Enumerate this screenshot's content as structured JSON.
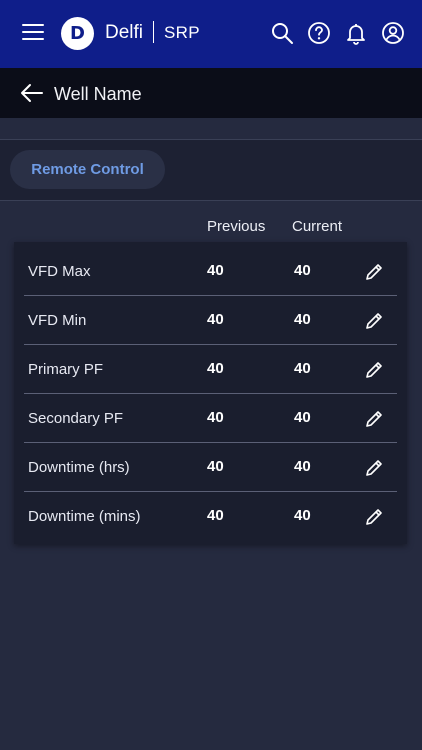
{
  "header": {
    "brand": "Delfi",
    "product": "SRP",
    "icons": [
      "menu-icon",
      "search-icon",
      "help-icon",
      "bell-icon",
      "user-icon"
    ],
    "color": "#0f1e8a"
  },
  "subheader": {
    "title": "Well Name"
  },
  "tabs": [
    {
      "label": "Remote Control",
      "active": true
    }
  ],
  "table": {
    "columns": {
      "previous": "Previous",
      "current": "Current"
    },
    "rows": [
      {
        "label": "VFD Max",
        "previous": "40",
        "current": "40"
      },
      {
        "label": "VFD Min",
        "previous": "40",
        "current": "40"
      },
      {
        "label": "Primary PF",
        "previous": "40",
        "current": "40"
      },
      {
        "label": "Secondary PF",
        "previous": "40",
        "current": "40"
      },
      {
        "label": "Downtime (hrs)",
        "previous": "40",
        "current": "40"
      },
      {
        "label": "Downtime (mins)",
        "previous": "40",
        "current": "40"
      }
    ]
  }
}
